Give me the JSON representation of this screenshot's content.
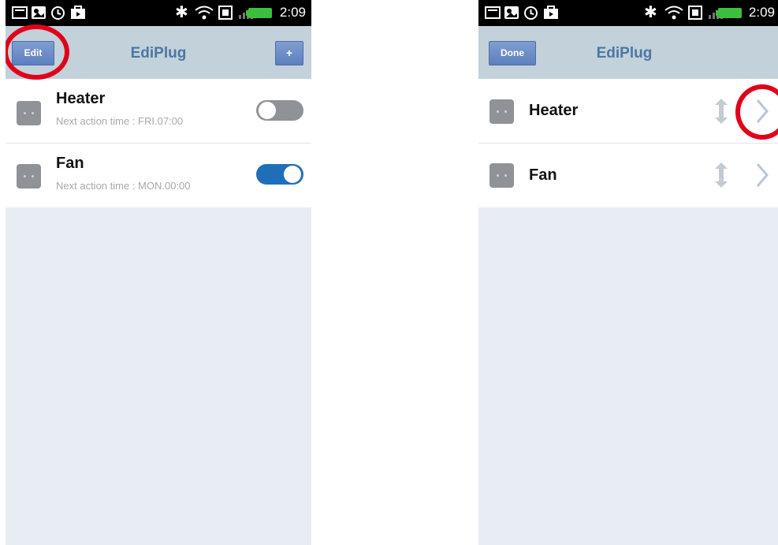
{
  "left_screen": {
    "status_time": "2:09",
    "title": "EdiPlug",
    "edit_label": "Edit",
    "add_label": "+",
    "devices": [
      {
        "name": "Heater",
        "next_action": "Next action time : FRI.07:00",
        "toggle_state": "off"
      },
      {
        "name": "Fan",
        "next_action": "Next action time : MON.00:00",
        "toggle_state": "on"
      }
    ]
  },
  "right_screen": {
    "status_time": "2:09",
    "title": "EdiPlug",
    "done_label": "Done",
    "devices": [
      {
        "name": "Heater"
      },
      {
        "name": "Fan"
      }
    ]
  },
  "colors": {
    "nav_bar": "#c3d1da",
    "title_text": "#4a77a6",
    "button": "#5d7fbd",
    "toggle_on": "#1f6fb8",
    "toggle_off": "#8f9398",
    "highlight_circle": "#e1001b"
  }
}
